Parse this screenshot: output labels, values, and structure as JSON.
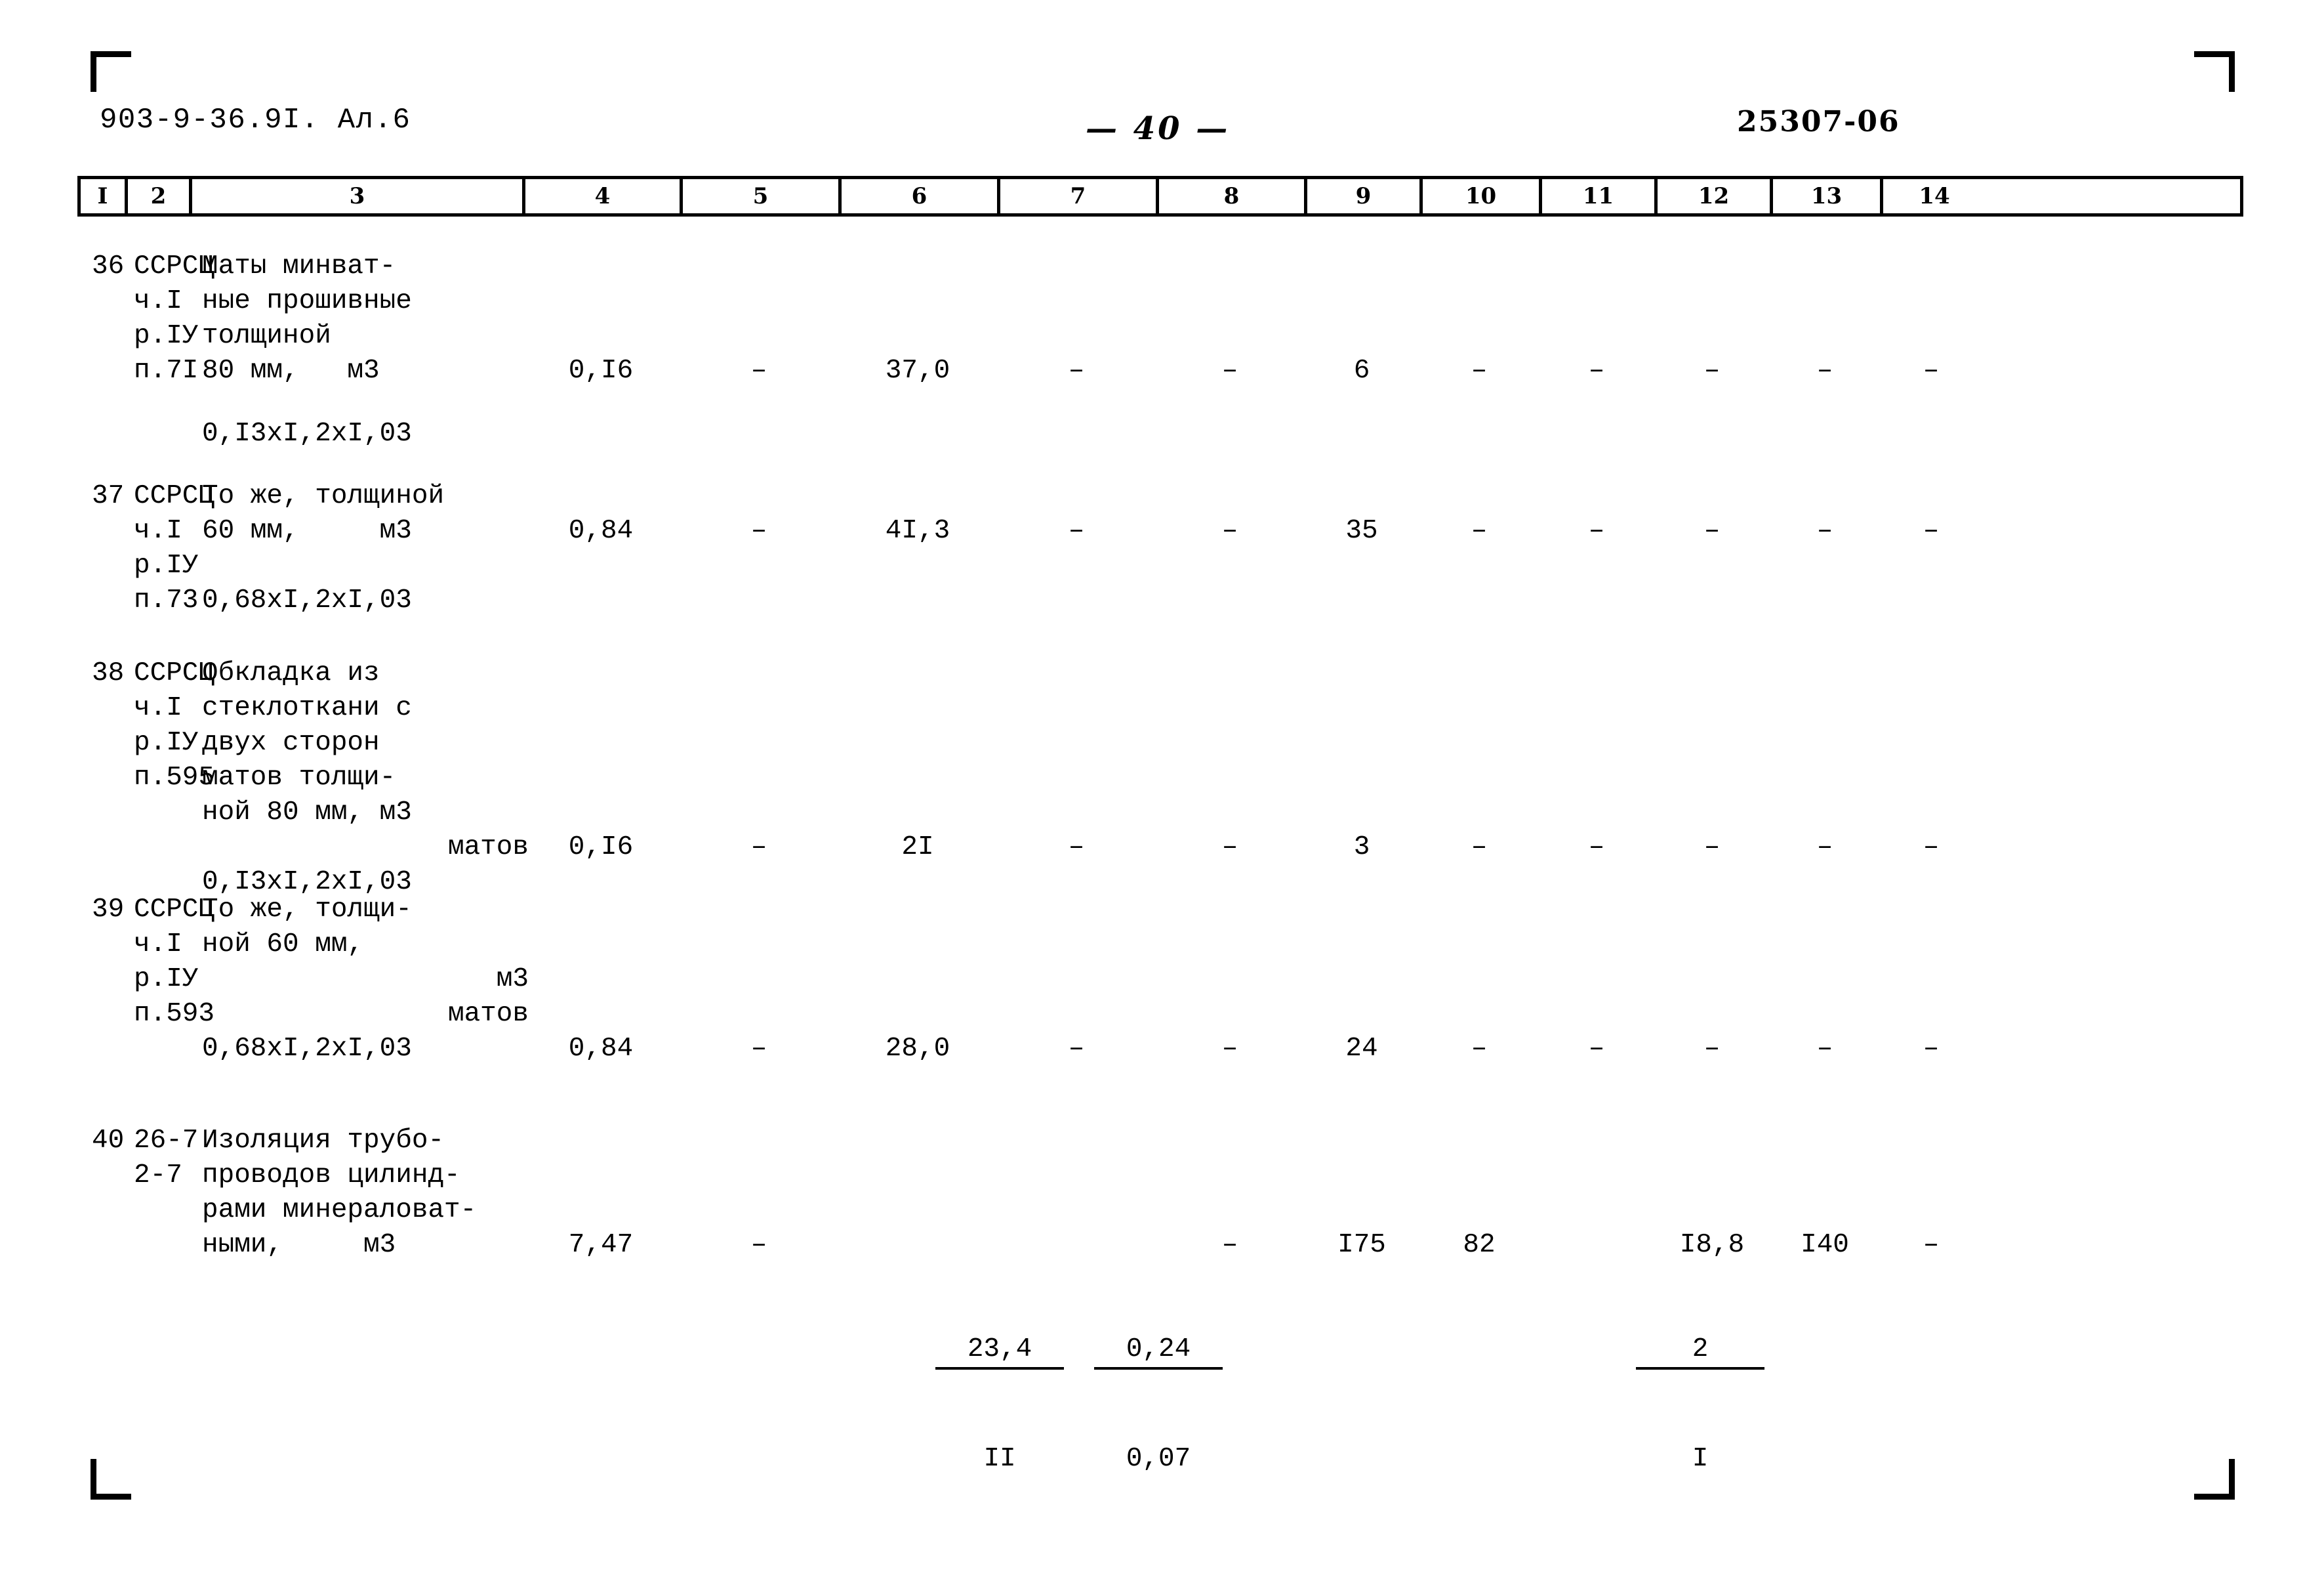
{
  "header": {
    "doc_code": "903-9-36.9I. Ал.6",
    "page_number": "— 40 —",
    "stamp_code": "25307-06"
  },
  "table": {
    "column_numbers": [
      "I",
      "2",
      "3",
      "4",
      "5",
      "6",
      "7",
      "8",
      "9",
      "10",
      "11",
      "12",
      "13",
      "14"
    ],
    "rows": [
      {
        "num": "36",
        "code": "ССРСЦ\nч.I\nр.IУ\nп.7I",
        "desc": "Маты минват-\nные прошивные\nтолщиной\n80 мм,   м3",
        "desc2": "0,I3xI,2xI,03",
        "c4": "0,I6",
        "c5": "–",
        "c6": "37,0",
        "c7": "–",
        "c8": "–",
        "c9": "6",
        "c10": "–",
        "c11": "–",
        "c12": "–",
        "c13": "–",
        "c14": "–"
      },
      {
        "num": "37",
        "code": "ССРСЦ\nч.I\nр.IУ\nп.73",
        "desc": "То же, толщиной\n60 мм,     м3",
        "desc2": "0,68xI,2xI,03",
        "c4": "0,84",
        "c5": "–",
        "c6": "4I,3",
        "c7": "–",
        "c8": "–",
        "c9": "35",
        "c10": "–",
        "c11": "–",
        "c12": "–",
        "c13": "–",
        "c14": "–"
      },
      {
        "num": "38",
        "code": "ССРСЦ\nч.I\nр.IУ\nп.595",
        "desc": "Обкладка из\nстеклоткани с\nдвух сторон\nматов толщи-\nной 80 мм, м3",
        "desc_right": "матов",
        "desc2": "0,I3xI,2xI,03",
        "c4": "0,I6",
        "c5": "–",
        "c6": "2I",
        "c7": "–",
        "c8": "–",
        "c9": "3",
        "c10": "–",
        "c11": "–",
        "c12": "–",
        "c13": "–",
        "c14": "–"
      },
      {
        "num": "39",
        "code": "ССРСЦ\nч.I\nр.IУ\nп.593",
        "desc": "То же, толщи-\nной 60 мм,",
        "desc_unit": "м3",
        "desc_right": "матов",
        "desc2": "0,68xI,2xI,03",
        "c4": "0,84",
        "c5": "–",
        "c6": "28,0",
        "c7": "–",
        "c8": "–",
        "c9": "24",
        "c10": "–",
        "c11": "–",
        "c12": "–",
        "c13": "–",
        "c14": "–"
      },
      {
        "num": "40",
        "code": "26-7\n2-7",
        "desc": "Изоляция трубо-\nпроводов цилинд-\nрами минераловат-\nными,     м3",
        "c4": "7,47",
        "c5": "–",
        "c6_top": "23,4",
        "c6_bot": "II",
        "c7_top": "0,24",
        "c7_bot": "0,07",
        "c8": "–",
        "c9": "I75",
        "c10": "82",
        "c11_top": "2",
        "c11_bot": "I",
        "c12": "I8,8",
        "c13": "I40",
        "c14": "–"
      }
    ]
  }
}
